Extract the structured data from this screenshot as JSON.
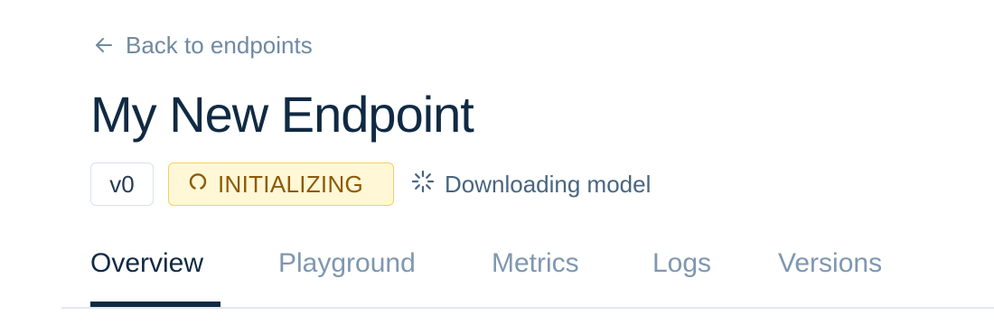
{
  "back_link": {
    "label": "Back to endpoints",
    "icon": "arrow-left-icon"
  },
  "title": "My New Endpoint",
  "version_badge": "v0",
  "status": {
    "label": "INITIALIZING",
    "icon": "loading-ring-icon",
    "detail": "Downloading model",
    "detail_icon": "spinner-icon",
    "colors": {
      "background": "#fff7d6",
      "border": "#f7cf63",
      "text": "#8d5a06"
    }
  },
  "tabs": [
    {
      "label": "Overview",
      "active": true
    },
    {
      "label": "Playground",
      "active": false
    },
    {
      "label": "Metrics",
      "active": false
    },
    {
      "label": "Logs",
      "active": false
    },
    {
      "label": "Versions",
      "active": false
    }
  ],
  "colors": {
    "title": "#102a43",
    "muted": "#7f97b0",
    "accent": "#102a43"
  }
}
